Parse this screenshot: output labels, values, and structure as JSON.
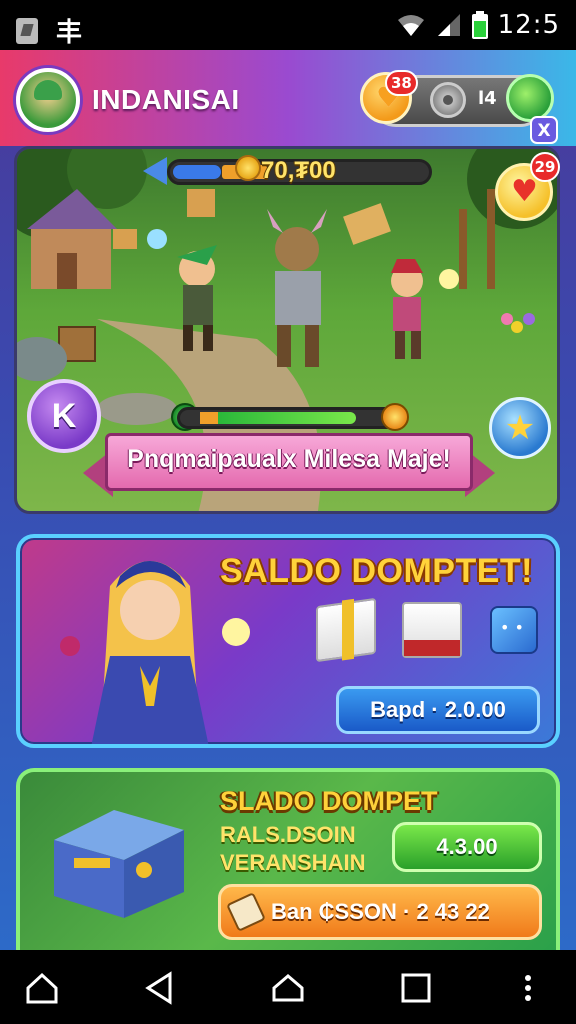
{
  "status_bar": {
    "time": "12:5",
    "left_glyph": "丰",
    "icons": [
      "image-icon",
      "wifi-icon",
      "signal-icon",
      "battery-icon"
    ]
  },
  "header": {
    "player_name": "INDANISAI",
    "hearts_badge": "38",
    "mid_value": "l4",
    "close_label": "X"
  },
  "scene": {
    "xp_value": "70,₮00",
    "heart_badge": "29",
    "k_label": "K",
    "ribbon_text": "Pnqmaipaualx Milesa Maje!"
  },
  "offer1": {
    "title": "SALDO DOMPTET!",
    "button_label": "Bapd · 2.0.00"
  },
  "offer2": {
    "title": "SLADO DOMPET",
    "subtitle_line1": "RALS.DSOIN",
    "subtitle_line2": "VERANSHAIN",
    "price_label": "4.3.00",
    "cta_label": "Ban ₵SSON · 2 43 22"
  },
  "nav": {
    "icons": [
      "home-outline-icon",
      "back-icon",
      "home-icon",
      "recents-icon",
      "more-icon"
    ]
  },
  "colors": {
    "accent_gold": "#ffd23a",
    "accent_pink": "#e46aae",
    "accent_blue": "#3a9af0",
    "accent_green": "#2aa02a",
    "accent_orange": "#f07a1a"
  }
}
